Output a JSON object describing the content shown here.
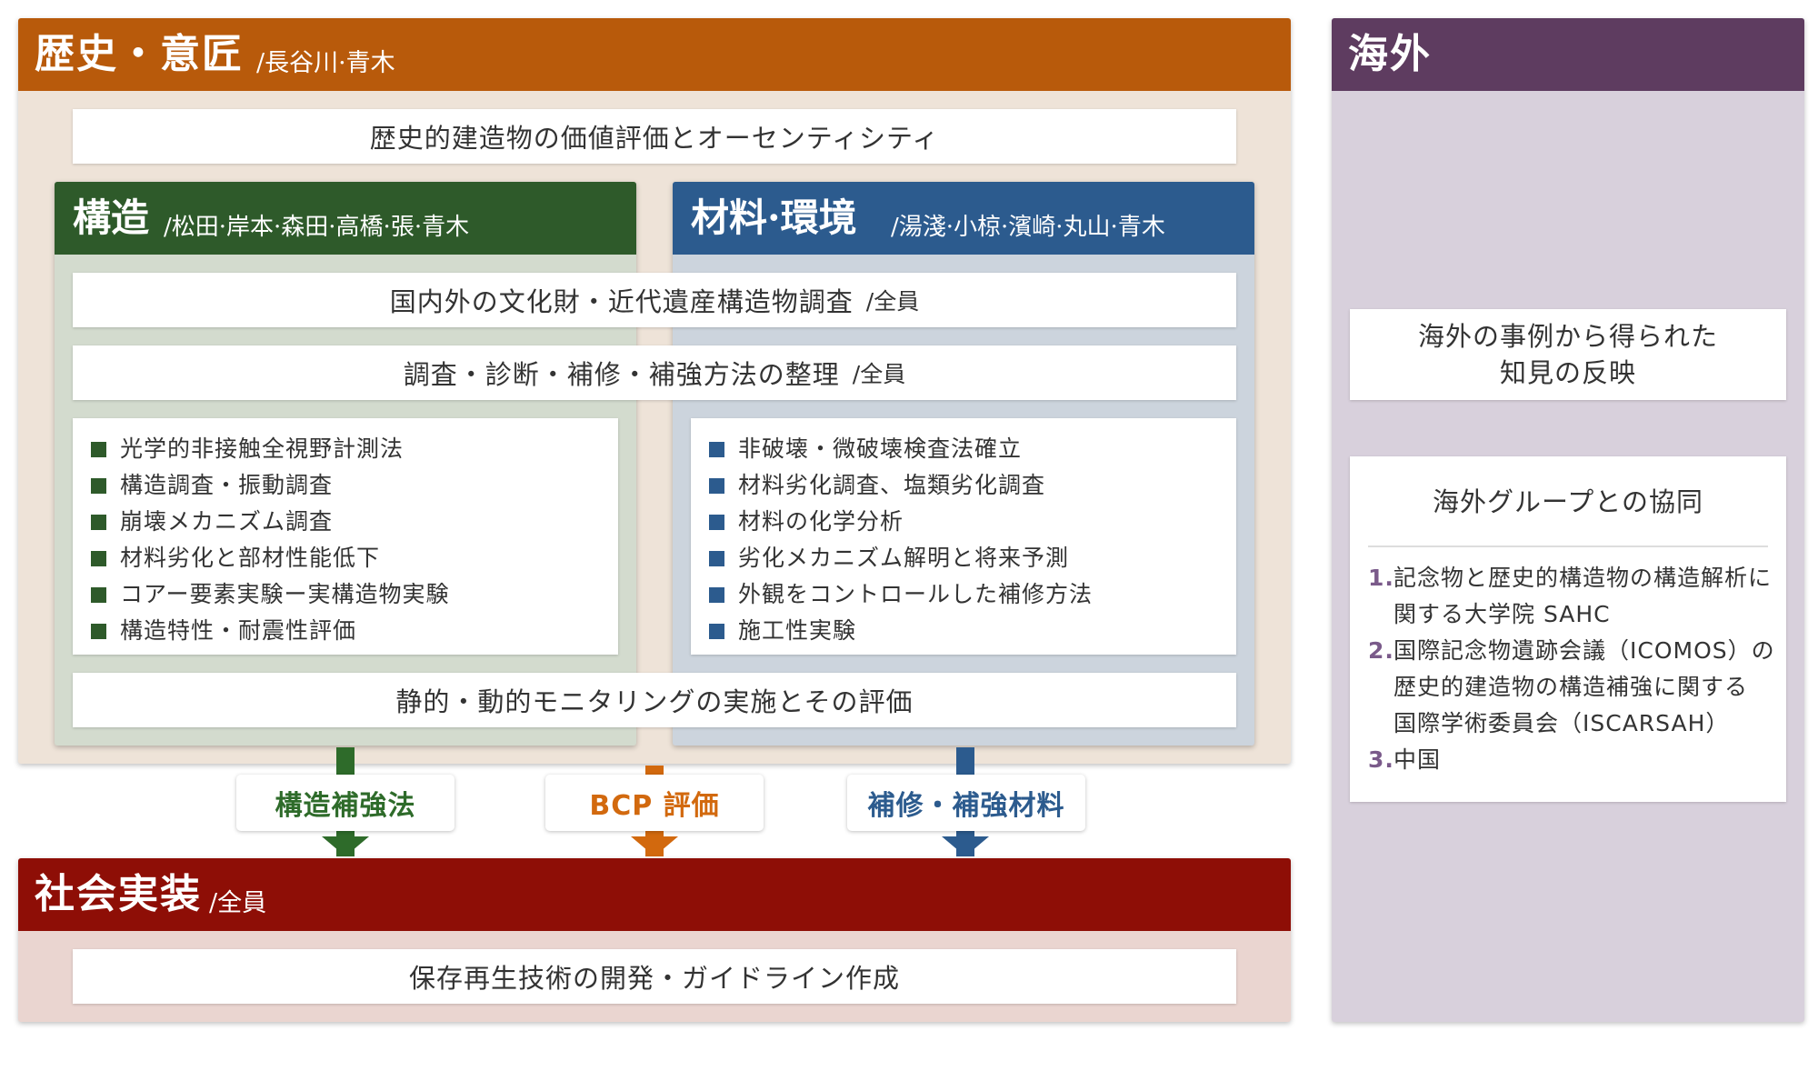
{
  "history": {
    "title": "歴史・意匠",
    "members": "/長谷川·青木",
    "top_box": "歴史的建造物の価値評価とオーセンティシティ",
    "color": "#B85A0B"
  },
  "structure": {
    "title": "構造",
    "members": "/松田·岸本·森田·高橋·張·青木",
    "color": "#2E5A2A",
    "items": [
      "光学的非接触全視野計測法",
      "構造調査・振動調査",
      "崩壊メカニズム調査",
      "材料劣化と部材性能低下",
      "コアー要素実験ー実構造物実験",
      "構造特性・耐震性評価"
    ]
  },
  "materials": {
    "title": "材料·環境",
    "members": "/湯淺·小椋·濱崎·丸山·青木",
    "color": "#2C5B8E",
    "items": [
      "非破壊・微破壊検査法確立",
      "材料劣化調査、塩類劣化調査",
      "材料の化学分析",
      "劣化メカニズム解明と将来予測",
      "外観をコントロールした補修方法",
      "施工性実験"
    ]
  },
  "shared": {
    "survey": "国内外の文化財・近代遺産構造物調査",
    "survey_suffix": "/全員",
    "methods": "調査・診断・補修・補強方法の整理",
    "methods_suffix": "/全員",
    "monitoring": "静的・動的モニタリングの実施とその評価"
  },
  "outputs": [
    {
      "label": "構造補強法",
      "color": "#2E6B2A"
    },
    {
      "label": "BCP 評価",
      "color": "#D2690E"
    },
    {
      "label": "補修・補強材料",
      "color": "#2C5B8E"
    }
  ],
  "social": {
    "title": "社会実装",
    "members": "/全員",
    "box": "保存再生技術の開発・ガイドライン作成",
    "color": "#8E0E06"
  },
  "overseas": {
    "title": "海外",
    "color": "#5E3C60",
    "box1": [
      "海外の事例から得られた",
      "知見の反映"
    ],
    "box2_title": "海外グループとの協同",
    "list": [
      {
        "num": "1.",
        "lines": [
          "記念物と歴史的構造物の構造解析に",
          "関する大学院 SAHC"
        ]
      },
      {
        "num": "2.",
        "lines": [
          "国際記念物遺跡会議（ICOMOS）の",
          "歴史的建造物の構造補強に関する",
          "国際学術委員会（ISCARSAH）"
        ]
      },
      {
        "num": "3.",
        "lines": [
          "中国"
        ]
      }
    ]
  }
}
